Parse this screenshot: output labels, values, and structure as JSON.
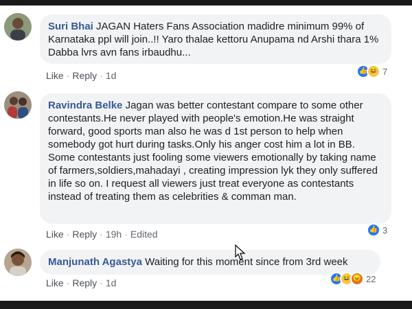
{
  "comments": [
    {
      "author": "Suri Bhai",
      "text": "JAGAN Haters Fans Association madidre minimum 99% of Karnataka ppl will join..!! Yaro thalae kettoru Anupama nd Arshi thara 1% Dabba lvrs avn fans irbaudhu...",
      "actions": {
        "like": "Like",
        "reply": "Reply",
        "time": "1d",
        "edited": ""
      },
      "reactions": {
        "icons": [
          "like",
          "haha"
        ],
        "count": "7"
      }
    },
    {
      "author": "Ravindra Belke",
      "text": "Jagan was better contestant compare to some other contestants.He never played with people's emotion.He was straight forward, good sports man also he was d 1st person to help when somebody got hurt during tasks.Only his anger cost him a lot in BB. Some contestants just fooling some viewers emotionally by taking name of farmers,soldiers,mahadayi , creating impression lyk they only suffered in life so on. I request all viewers just treat everyone as contestants instead of treating them as celebrities & comman man.",
      "actions": {
        "like": "Like",
        "reply": "Reply",
        "time": "19h",
        "edited": "Edited"
      },
      "reactions": {
        "icons": [
          "like"
        ],
        "count": "3"
      }
    },
    {
      "author": "Manjunath Agastya",
      "text": "Waiting for this moment since from 3rd week",
      "actions": {
        "like": "Like",
        "reply": "Reply",
        "time": "1d",
        "edited": ""
      },
      "reactions": {
        "icons": [
          "like",
          "haha",
          "angry"
        ],
        "count": "22"
      }
    }
  ],
  "separator": "·",
  "colors": {
    "author": "#385898",
    "bubble": "#f2f3f5",
    "like_reaction": "#2078f4",
    "haha_reaction": "#f7c948",
    "angry_reaction": "#e9710f"
  }
}
